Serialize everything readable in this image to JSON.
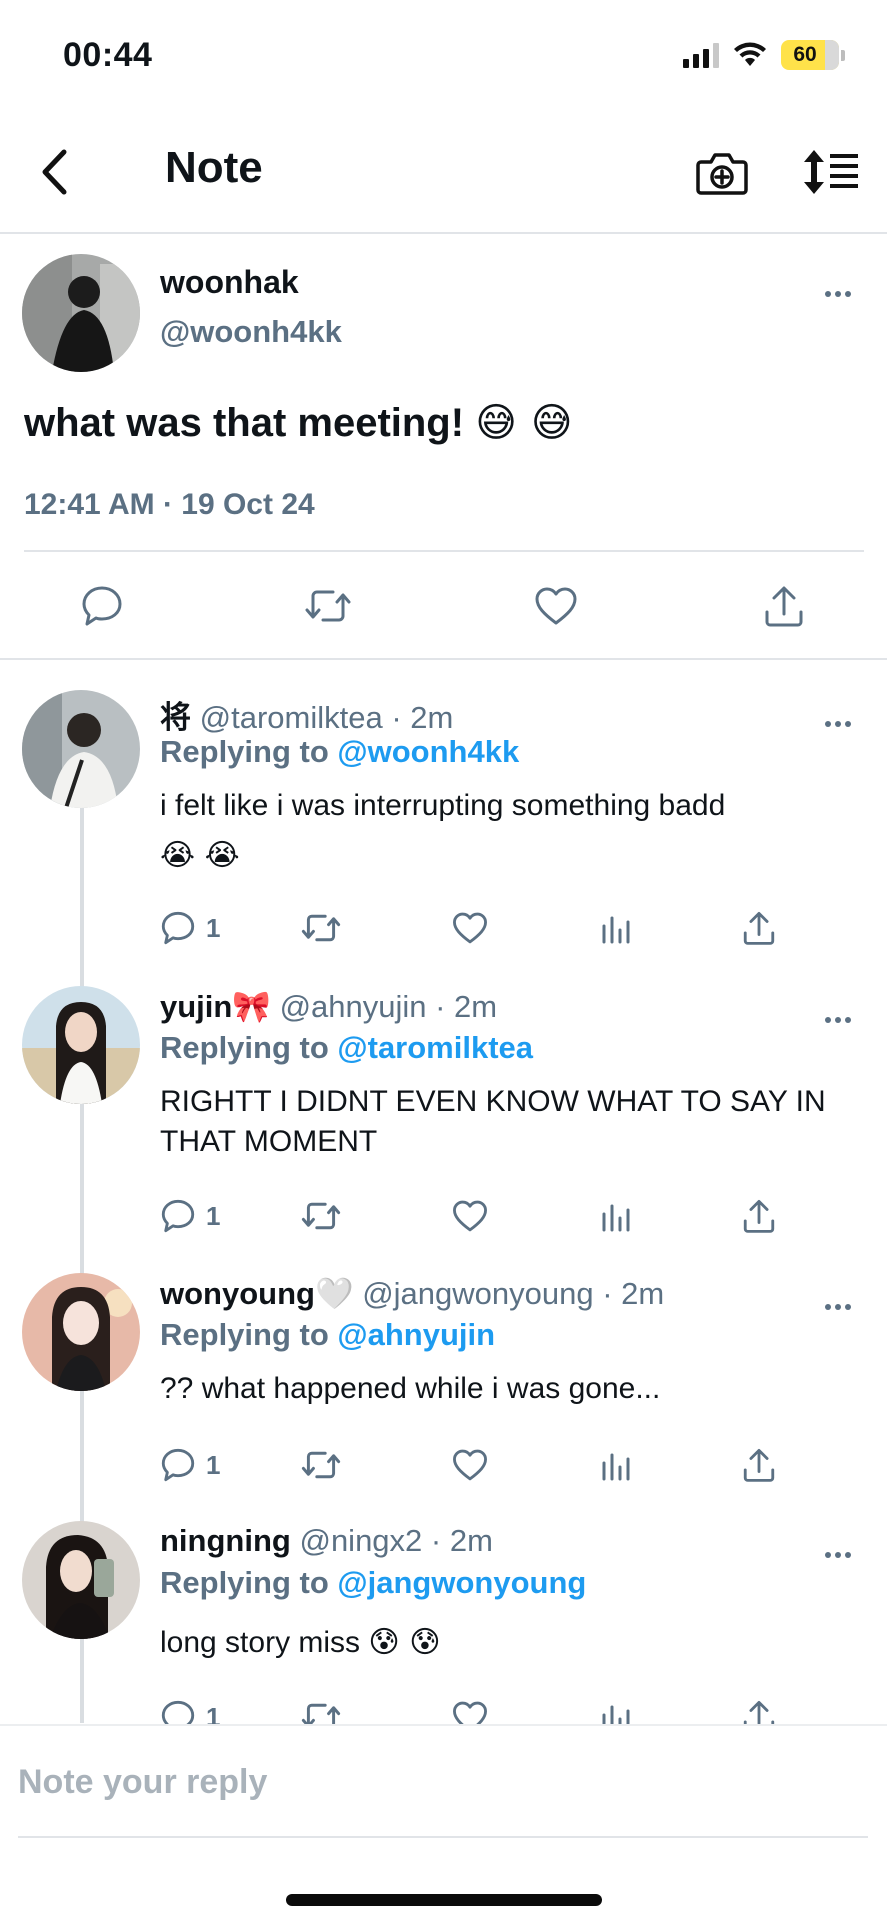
{
  "status_bar": {
    "time": "00:44",
    "battery": "60"
  },
  "nav": {
    "title": "Note",
    "icons": [
      "back-chevron-icon",
      "camera-plus-icon",
      "sort-icon"
    ]
  },
  "main_tweet": {
    "name": "woonhak",
    "handle": "@woonh4kk",
    "text": "what was that meeting!",
    "emoji": "😅 😅",
    "timestamp": "12:41 AM · 19 Oct 24",
    "actions": [
      "reply-icon",
      "retweet-icon",
      "like-icon",
      "share-icon"
    ]
  },
  "replies": [
    {
      "name": "将",
      "handle": "@taromilktea · 2m",
      "replying_prefix": "Replying to ",
      "replying_to": "@woonh4kk",
      "text": "i felt like i was interrupting something badd",
      "text_emoji": "😭 😭",
      "reply_count": "1",
      "avatar_color": "#9aa3a8"
    },
    {
      "name": "yujin🎀",
      "handle": "@ahnyujin · 2m",
      "replying_prefix": "Replying to ",
      "replying_to": "@taromilktea",
      "text": "RIGHTT I DIDNT EVEN KNOW WHAT TO SAY IN THAT MOMENT",
      "text_emoji": "",
      "reply_count": "1",
      "avatar_color": "#c9b79a"
    },
    {
      "name": "wonyoung🤍",
      "handle": "@jangwonyoung · 2m",
      "replying_prefix": "Replying to ",
      "replying_to": "@ahnyujin",
      "text": "?? what happened while i was gone...",
      "text_emoji": "",
      "reply_count": "1",
      "avatar_color": "#d8a7a0"
    },
    {
      "name": "ningning",
      "handle": "@ningx2 · 2m",
      "replying_prefix": "Replying to ",
      "replying_to": "@jangwonyoung",
      "text": "long story miss",
      "text_emoji": "😰 😰",
      "reply_count": "1",
      "avatar_color": "#3a2f2c"
    }
  ],
  "composer": {
    "placeholder": "Note your reply"
  },
  "colors": {
    "link": "#1d9bf0",
    "muted": "#5b7083",
    "text": "#0f1419"
  }
}
